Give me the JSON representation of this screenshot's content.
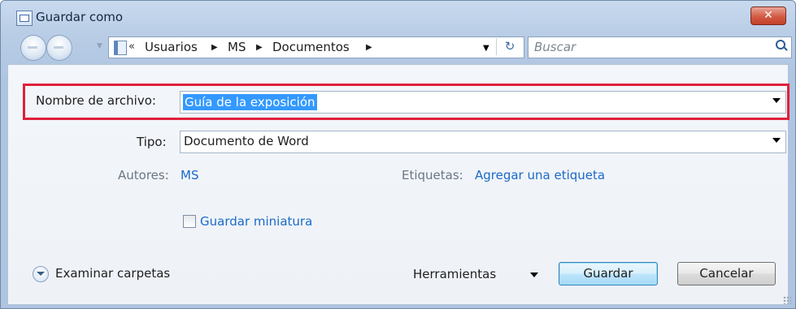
{
  "window": {
    "title": "Guardar como",
    "close_label": "✕"
  },
  "nav": {
    "breadcrumb_prefix": "«",
    "breadcrumbs": [
      "Usuarios",
      "MS",
      "Documentos"
    ],
    "search_placeholder": "Buscar"
  },
  "form": {
    "filename_label": "Nombre de archivo:",
    "filename_value": "Guía de la exposición",
    "type_label": "Tipo:",
    "type_value": "Documento de Word",
    "authors_label": "Autores:",
    "authors_value": "MS",
    "tags_label": "Etiquetas:",
    "tags_value": "Agregar una etiqueta",
    "thumbnail_label": "Guardar miniatura",
    "thumbnail_checked": false
  },
  "footer": {
    "browse_label": "Examinar carpetas",
    "tools_label": "Herramientas",
    "save_label": "Guardar",
    "cancel_label": "Cancelar"
  },
  "colors": {
    "highlight": "#e1203a",
    "link": "#1b6ac9",
    "selection": "#3399ff"
  }
}
